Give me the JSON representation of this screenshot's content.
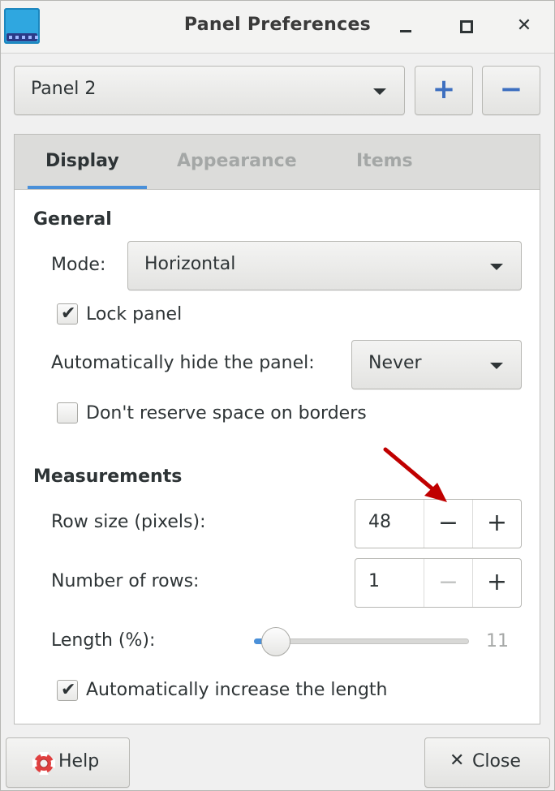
{
  "window": {
    "title": "Panel Preferences",
    "close_glyph": "✕"
  },
  "panel_selector": {
    "value": "Panel 2",
    "add_glyph": "+",
    "remove_glyph": "−"
  },
  "tabs": [
    {
      "label": "Display",
      "active": true
    },
    {
      "label": "Appearance",
      "active": false
    },
    {
      "label": "Items",
      "active": false
    }
  ],
  "general": {
    "heading": "General",
    "mode_label": "Mode:",
    "mode_value": "Horizontal",
    "lock_panel_label": "Lock panel",
    "lock_panel_checked": true,
    "autohide_label": "Automatically hide the panel:",
    "autohide_value": "Never",
    "reserve_space_label": "Don't reserve space on borders",
    "reserve_space_checked": false
  },
  "measurements": {
    "heading": "Measurements",
    "row_size_label": "Row size (pixels):",
    "row_size_value": "48",
    "rows_label": "Number of rows:",
    "rows_value": "1",
    "minus_glyph": "−",
    "plus_glyph": "+",
    "length_label": "Length (%):",
    "length_value": "11",
    "auto_length_label": "Automatically increase the length",
    "auto_length_checked": true
  },
  "footer": {
    "help_label": "Help",
    "close_label": "Close",
    "close_glyph": "✕"
  },
  "colors": {
    "accent": "#4a90d9",
    "annotation_arrow": "#c00000"
  },
  "icons": {
    "app": "xfce-panel-icon",
    "help": "lifebuoy-icon"
  }
}
